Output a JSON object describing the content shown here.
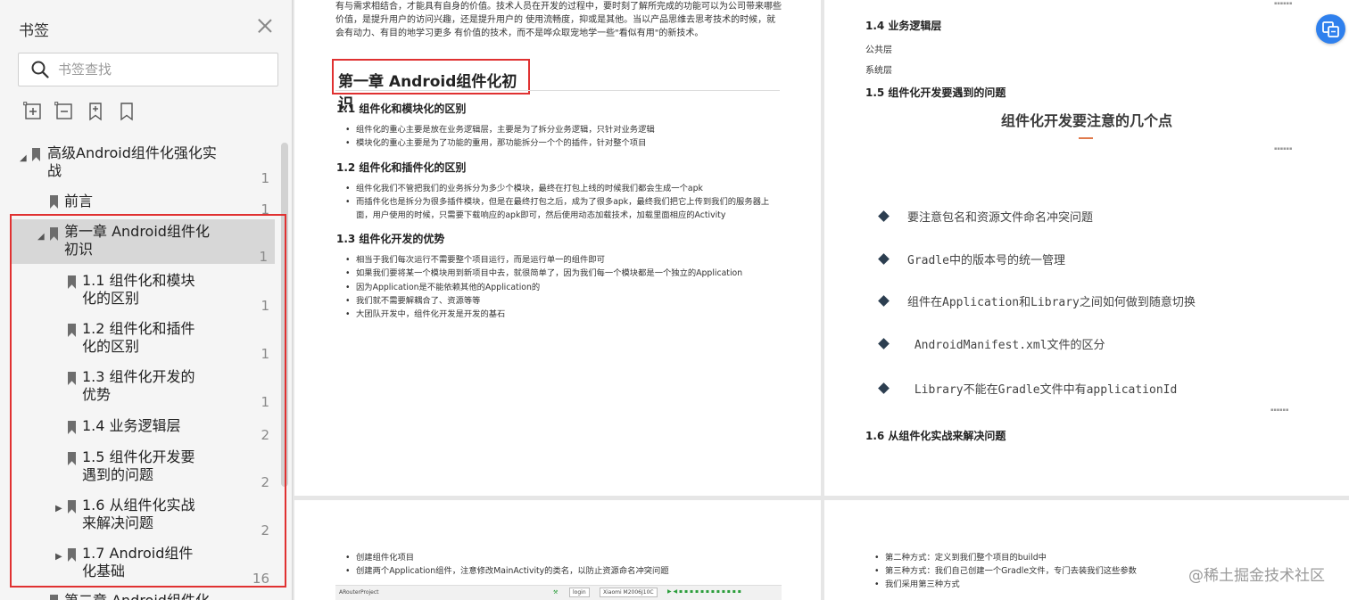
{
  "sidebar": {
    "title": "书签",
    "search_placeholder": "书签查找",
    "bookmarks": [
      {
        "label": "高级Android组件化强化实战",
        "page": "1"
      },
      {
        "label": "前言",
        "page": "1"
      },
      {
        "label": "第一章 Android组件化初识",
        "page": "1"
      },
      {
        "label": "1.1 组件化和模块化的区别",
        "page": "1"
      },
      {
        "label": "1.2 组件化和插件化的区别",
        "page": "1"
      },
      {
        "label": "1.3 组件化开发的优势",
        "page": "1"
      },
      {
        "label": "1.4 业务逻辑层",
        "page": "2"
      },
      {
        "label": "1.5 组件化开发要遇到的问题",
        "page": "2"
      },
      {
        "label": "1.6 从组件化实战来解决问题",
        "page": "2"
      },
      {
        "label": "1.7 Android组件化基础",
        "page": "16"
      },
      {
        "label": "第二章 Android组件化",
        "page": ""
      }
    ]
  },
  "page1": {
    "intro": "有与需求相结合，才能具有自身的价值。技术人员在开发的过程中，要时刻了解所完成的功能可以为公司带来哪些价值，是提升用户的访问兴趣，还是提升用户的 使用流畅度，抑或是其他。当以产品思维去思考技术的时候，就会有动力、有目的地学习更多 有价值的技术，而不是哗众取宠地学一些\"看似有用\"的新技术。",
    "chapter_title": "第一章 Android组件化初识",
    "sections": [
      {
        "heading": "1.1 组件化和模块化的区别",
        "bullets": [
          "组件化的重心主要是放在业务逻辑层，主要是为了拆分业务逻辑，只针对业务逻辑",
          "模块化的重心主要是为了功能的重用，那功能拆分一个个的插件，针对整个项目"
        ]
      },
      {
        "heading": "1.2 组件化和插件化的区别",
        "bullets": [
          "组件化我们不管把我们的业务拆分为多少个模块，最终在打包上线的时候我们都会生成一个apk",
          "而插件化也是拆分为很多插件模块，但是在最终打包之后，成为了很多apk，最终我们把它上传到我们的服务器上面，用户使用的时候，只需要下载响应的apk即可，然后使用动态加载技术，加载里面相应的Activity"
        ]
      },
      {
        "heading": "1.3 组件化开发的优势",
        "bullets": [
          "相当于我们每次运行不需要整个项目运行，而是运行单一的组件即可",
          "如果我们要将某一个模块用到新项目中去，就很简单了，因为我们每一个模块都是一个独立的Application",
          "因为Application是不能依赖其他的Application的",
          "我们就不需要解耦合了、资源等等",
          "大团队开发中，组件化开发是开发的基石"
        ]
      }
    ]
  },
  "page2": {
    "heading_14": "1.4 业务逻辑层",
    "line_public": "公共层",
    "line_system": "系统层",
    "heading_15": "1.5 组件化开发要遇到的问题",
    "slide_title": "组件化开发要注意的几个点",
    "slide_items": [
      "要注意包名和资源文件命名冲突问题",
      "Gradle中的版本号的统一管理",
      "组件在Application和Library之间如何做到随意切换",
      " AndroidManifest.xml文件的区分",
      " Library不能在Gradle文件中有applicationId"
    ],
    "heading_16": "1.6 从组件化实战来解决问题"
  },
  "page3": {
    "bullets": [
      "创建组件化项目",
      "创建两个Application组件，注意修改MainActivity的类名，以防止资源命名冲突问题"
    ],
    "toolbar_project": "ARouterProject",
    "toolbar_module": "login",
    "toolbar_device": "Xiaomi M2006J10C"
  },
  "page4": {
    "bullets": [
      "第二种方式：定义到我们整个项目的build中",
      "第三种方式：我们自己创建一个Gradle文件，专门去装我们这些参数",
      "我们采用第三种方式"
    ]
  },
  "watermark": "@稀土掘金技术社区",
  "colors": {
    "highlight": "#e03131",
    "accent": "#2f80ed",
    "selected_bg": "#d7d7d7"
  }
}
